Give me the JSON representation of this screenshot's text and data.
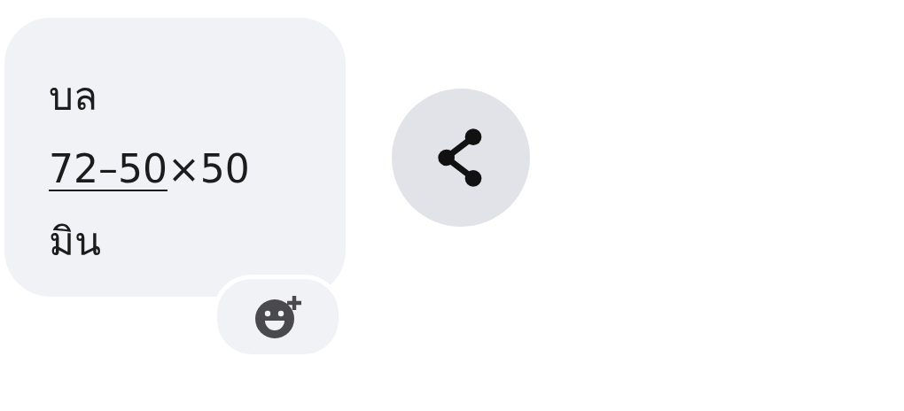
{
  "message": {
    "segments": [
      {
        "kind": "text",
        "text": "บล"
      },
      {
        "kind": "break"
      },
      {
        "kind": "link",
        "text": "72–50"
      },
      {
        "kind": "text",
        "text": "×50"
      },
      {
        "kind": "break"
      },
      {
        "kind": "text",
        "text": "มิน"
      }
    ]
  },
  "share_button": {
    "kind": "share"
  },
  "reaction_button": {
    "kind": "add-emoji"
  }
}
